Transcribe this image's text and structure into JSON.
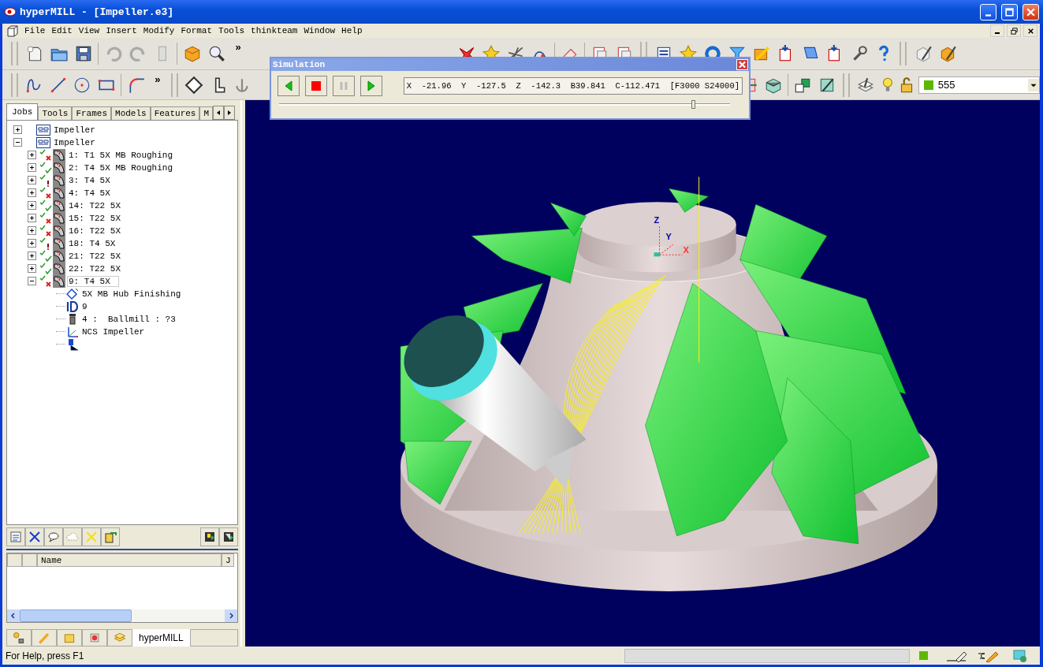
{
  "window": {
    "title": "hyperMILL - [Impeller.e3]"
  },
  "menu": [
    "File",
    "Edit",
    "View",
    "Insert",
    "Modify",
    "Format",
    "Tools",
    "thinkteam",
    "Window",
    "Help"
  ],
  "toolbar_chevrons": [
    "»",
    "»"
  ],
  "layer_box": {
    "value": "555",
    "color": "#5cb800"
  },
  "tabs": [
    {
      "label": "Jobs",
      "selected": true
    },
    {
      "label": "Tools",
      "selected": false
    },
    {
      "label": "Frames",
      "selected": false
    },
    {
      "label": "Models",
      "selected": false
    },
    {
      "label": "Features",
      "selected": false
    },
    {
      "label": "M",
      "selected": false
    }
  ],
  "tree": [
    {
      "kind": "project",
      "label": "Impeller",
      "expanded": false,
      "selected": false
    },
    {
      "kind": "project",
      "label": "Impeller",
      "expanded": true,
      "selected": false,
      "children": [
        {
          "kind": "job",
          "label": "1: T1 5X MB Roughing",
          "error": true,
          "warning": false,
          "expanded": false,
          "selected": false
        },
        {
          "kind": "job",
          "label": "2: T4 5X MB Roughing",
          "error": false,
          "warning": false,
          "expanded": false,
          "selected": false
        },
        {
          "kind": "job",
          "label": "3: T4 5X",
          "error": false,
          "warning": true,
          "expanded": false,
          "selected": false
        },
        {
          "kind": "job",
          "label": "4: T4 5X",
          "error": true,
          "warning": false,
          "expanded": false,
          "selected": false
        },
        {
          "kind": "job",
          "label": "14: T22 5X",
          "error": false,
          "warning": false,
          "expanded": false,
          "selected": false
        },
        {
          "kind": "job",
          "label": "15: T22 5X",
          "error": true,
          "warning": false,
          "expanded": false,
          "selected": false
        },
        {
          "kind": "job",
          "label": "16: T22 5X",
          "error": true,
          "warning": false,
          "expanded": false,
          "selected": false
        },
        {
          "kind": "job",
          "label": "18: T4 5X",
          "error": false,
          "warning": true,
          "expanded": false,
          "selected": false
        },
        {
          "kind": "job",
          "label": "21: T22 5X",
          "error": false,
          "warning": false,
          "expanded": false,
          "selected": false
        },
        {
          "kind": "job",
          "label": "22: T22 5X",
          "error": false,
          "warning": false,
          "expanded": false,
          "selected": false
        },
        {
          "kind": "job",
          "label": "9: T4 5X",
          "error": true,
          "warning": false,
          "expanded": true,
          "selected": true,
          "children": [
            {
              "kind": "cycle",
              "label": "5X MB Hub Finishing"
            },
            {
              "kind": "id",
              "label": "9"
            },
            {
              "kind": "tool",
              "label": "4 :  Ballmill : ?3"
            },
            {
              "kind": "frame",
              "label": "NCS Impeller"
            },
            {
              "kind": "post"
            }
          ]
        }
      ]
    }
  ],
  "list": {
    "columns": [
      "Name",
      "J"
    ]
  },
  "panel_tabs": [
    {
      "kind": "geometry",
      "selected": false
    },
    {
      "kind": "pen",
      "selected": false
    },
    {
      "kind": "note",
      "selected": false
    },
    {
      "kind": "record",
      "selected": false
    },
    {
      "kind": "layers",
      "selected": false
    },
    {
      "kind": "text",
      "label": "hyperMILL",
      "selected": true
    }
  ],
  "simulation": {
    "title": "Simulation",
    "readout": "X  -21.96  Y  -127.5  Z  -142.3  B39.841  C-112.471  [F3000 S24000]",
    "level": 0.92
  },
  "viewport": {
    "axes": [
      "Z",
      "Y",
      "X"
    ]
  },
  "status_bar": {
    "text": "For Help, press F1",
    "color": "#5cb800"
  }
}
